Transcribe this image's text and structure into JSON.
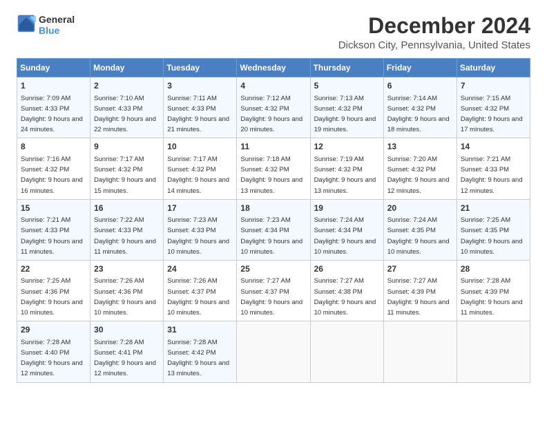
{
  "logo": {
    "text_general": "General",
    "text_blue": "Blue"
  },
  "title": {
    "month": "December 2024",
    "location": "Dickson City, Pennsylvania, United States"
  },
  "calendar": {
    "headers": [
      "Sunday",
      "Monday",
      "Tuesday",
      "Wednesday",
      "Thursday",
      "Friday",
      "Saturday"
    ],
    "weeks": [
      [
        {
          "day": "1",
          "sunrise": "7:09 AM",
          "sunset": "4:33 PM",
          "daylight": "9 hours and 24 minutes."
        },
        {
          "day": "2",
          "sunrise": "7:10 AM",
          "sunset": "4:33 PM",
          "daylight": "9 hours and 22 minutes."
        },
        {
          "day": "3",
          "sunrise": "7:11 AM",
          "sunset": "4:33 PM",
          "daylight": "9 hours and 21 minutes."
        },
        {
          "day": "4",
          "sunrise": "7:12 AM",
          "sunset": "4:32 PM",
          "daylight": "9 hours and 20 minutes."
        },
        {
          "day": "5",
          "sunrise": "7:13 AM",
          "sunset": "4:32 PM",
          "daylight": "9 hours and 19 minutes."
        },
        {
          "day": "6",
          "sunrise": "7:14 AM",
          "sunset": "4:32 PM",
          "daylight": "9 hours and 18 minutes."
        },
        {
          "day": "7",
          "sunrise": "7:15 AM",
          "sunset": "4:32 PM",
          "daylight": "9 hours and 17 minutes."
        }
      ],
      [
        {
          "day": "8",
          "sunrise": "7:16 AM",
          "sunset": "4:32 PM",
          "daylight": "9 hours and 16 minutes."
        },
        {
          "day": "9",
          "sunrise": "7:17 AM",
          "sunset": "4:32 PM",
          "daylight": "9 hours and 15 minutes."
        },
        {
          "day": "10",
          "sunrise": "7:17 AM",
          "sunset": "4:32 PM",
          "daylight": "9 hours and 14 minutes."
        },
        {
          "day": "11",
          "sunrise": "7:18 AM",
          "sunset": "4:32 PM",
          "daylight": "9 hours and 13 minutes."
        },
        {
          "day": "12",
          "sunrise": "7:19 AM",
          "sunset": "4:32 PM",
          "daylight": "9 hours and 13 minutes."
        },
        {
          "day": "13",
          "sunrise": "7:20 AM",
          "sunset": "4:32 PM",
          "daylight": "9 hours and 12 minutes."
        },
        {
          "day": "14",
          "sunrise": "7:21 AM",
          "sunset": "4:33 PM",
          "daylight": "9 hours and 12 minutes."
        }
      ],
      [
        {
          "day": "15",
          "sunrise": "7:21 AM",
          "sunset": "4:33 PM",
          "daylight": "9 hours and 11 minutes."
        },
        {
          "day": "16",
          "sunrise": "7:22 AM",
          "sunset": "4:33 PM",
          "daylight": "9 hours and 11 minutes."
        },
        {
          "day": "17",
          "sunrise": "7:23 AM",
          "sunset": "4:33 PM",
          "daylight": "9 hours and 10 minutes."
        },
        {
          "day": "18",
          "sunrise": "7:23 AM",
          "sunset": "4:34 PM",
          "daylight": "9 hours and 10 minutes."
        },
        {
          "day": "19",
          "sunrise": "7:24 AM",
          "sunset": "4:34 PM",
          "daylight": "9 hours and 10 minutes."
        },
        {
          "day": "20",
          "sunrise": "7:24 AM",
          "sunset": "4:35 PM",
          "daylight": "9 hours and 10 minutes."
        },
        {
          "day": "21",
          "sunrise": "7:25 AM",
          "sunset": "4:35 PM",
          "daylight": "9 hours and 10 minutes."
        }
      ],
      [
        {
          "day": "22",
          "sunrise": "7:25 AM",
          "sunset": "4:36 PM",
          "daylight": "9 hours and 10 minutes."
        },
        {
          "day": "23",
          "sunrise": "7:26 AM",
          "sunset": "4:36 PM",
          "daylight": "9 hours and 10 minutes."
        },
        {
          "day": "24",
          "sunrise": "7:26 AM",
          "sunset": "4:37 PM",
          "daylight": "9 hours and 10 minutes."
        },
        {
          "day": "25",
          "sunrise": "7:27 AM",
          "sunset": "4:37 PM",
          "daylight": "9 hours and 10 minutes."
        },
        {
          "day": "26",
          "sunrise": "7:27 AM",
          "sunset": "4:38 PM",
          "daylight": "9 hours and 10 minutes."
        },
        {
          "day": "27",
          "sunrise": "7:27 AM",
          "sunset": "4:39 PM",
          "daylight": "9 hours and 11 minutes."
        },
        {
          "day": "28",
          "sunrise": "7:28 AM",
          "sunset": "4:39 PM",
          "daylight": "9 hours and 11 minutes."
        }
      ],
      [
        {
          "day": "29",
          "sunrise": "7:28 AM",
          "sunset": "4:40 PM",
          "daylight": "9 hours and 12 minutes."
        },
        {
          "day": "30",
          "sunrise": "7:28 AM",
          "sunset": "4:41 PM",
          "daylight": "9 hours and 12 minutes."
        },
        {
          "day": "31",
          "sunrise": "7:28 AM",
          "sunset": "4:42 PM",
          "daylight": "9 hours and 13 minutes."
        },
        null,
        null,
        null,
        null
      ]
    ]
  }
}
